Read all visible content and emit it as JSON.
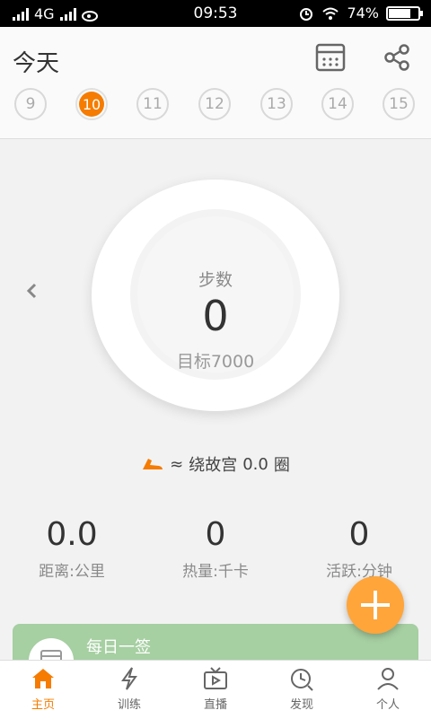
{
  "status_bar": {
    "network": "4G",
    "time": "09:53",
    "battery_percent": "74%",
    "battery_level": 0.74
  },
  "header": {
    "title": "今天",
    "days": [
      "9",
      "10",
      "11",
      "12",
      "13",
      "14",
      "15"
    ],
    "selected_day": "10",
    "icons": {
      "calendar": "calendar-icon",
      "share": "share-icon"
    }
  },
  "steps": {
    "label": "步数",
    "value": "0",
    "goal_label": "目标7000"
  },
  "equivalence": {
    "prefix": "≈",
    "text": "绕故宫",
    "value": "0.0",
    "unit": "圈",
    "icon": "shoe-icon"
  },
  "stats": [
    {
      "value": "0.0",
      "label": "距离:公里"
    },
    {
      "value": "0",
      "label": "热量:千卡"
    },
    {
      "value": "0",
      "label": "活跃:分钟"
    }
  ],
  "daily_card": {
    "title": "每日一签",
    "icon": "calendar-icon"
  },
  "tabs": [
    {
      "label": "主页",
      "icon": "home-icon",
      "active": true
    },
    {
      "label": "训练",
      "icon": "lightning-icon",
      "active": false
    },
    {
      "label": "直播",
      "icon": "tv-icon",
      "active": false
    },
    {
      "label": "发现",
      "icon": "discover-icon",
      "active": false
    },
    {
      "label": "个人",
      "icon": "person-icon",
      "active": false
    }
  ],
  "colors": {
    "accent": "#f57c00",
    "fab": "#ffa53a",
    "card": "#a6cfa2"
  }
}
